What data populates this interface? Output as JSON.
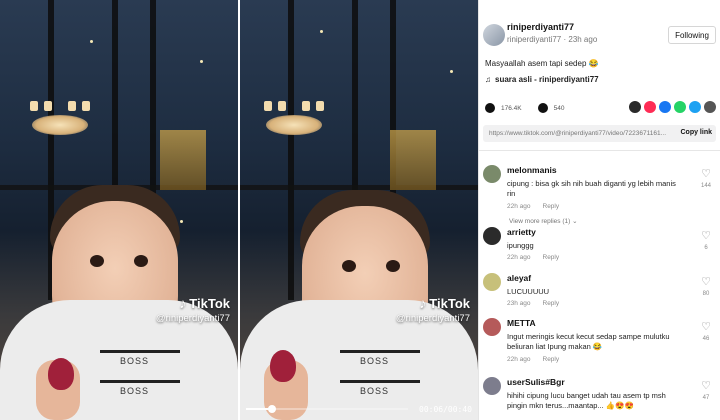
{
  "video": {
    "tiktok_label": "TikTok",
    "handle": "@riniperdiyanti77",
    "time": "00:06/00:40",
    "progress": 0.16,
    "shirt_text_1": "BOSS",
    "shirt_text_2": "BOSS"
  },
  "header": {
    "username": "riniperdiyanti77",
    "subline": "riniperdiyanti77 · 23h ago",
    "follow_label": "Following",
    "caption": "Masyaallah asem tapi sedep 😂",
    "music": "suara asli - riniperdiyanti77",
    "likes": "176.4K",
    "comments": "540",
    "link": "https://www.tiktok.com/@riniperdiyanti77/video/7223671161...",
    "copy_label": "Copy link",
    "share_colors": [
      "#2a2a2a",
      "#fe2c55",
      "#1877f2",
      "#25d366",
      "#1da1f2",
      "#555555"
    ]
  },
  "comments": [
    {
      "name": "melonmanis",
      "text": "cipung : bisa gk sih nih buah diganti yg lebih manis rin",
      "age": "22h ago",
      "reply": "Reply",
      "likes": "144",
      "more": "View more replies (1)"
    },
    {
      "name": "arrietty",
      "text": "ipunggg",
      "age": "22h ago",
      "reply": "Reply",
      "likes": "6"
    },
    {
      "name": "aleyaf",
      "text": "LUCUUUUU",
      "age": "23h ago",
      "reply": "Reply",
      "likes": "80"
    },
    {
      "name": "METTA",
      "text": "Ingut meringis kecut kecut sedap sampe mulutku beliuran liat Ipung makan 😂",
      "age": "22h ago",
      "reply": "Reply",
      "likes": "46"
    },
    {
      "name": "userSulis#Bgr",
      "text": "hihihi cipung lucu banget udah tau asem tp msh pingin mkn terus...maantap... 👍😍😍",
      "age": "",
      "reply": "",
      "likes": "47"
    }
  ]
}
